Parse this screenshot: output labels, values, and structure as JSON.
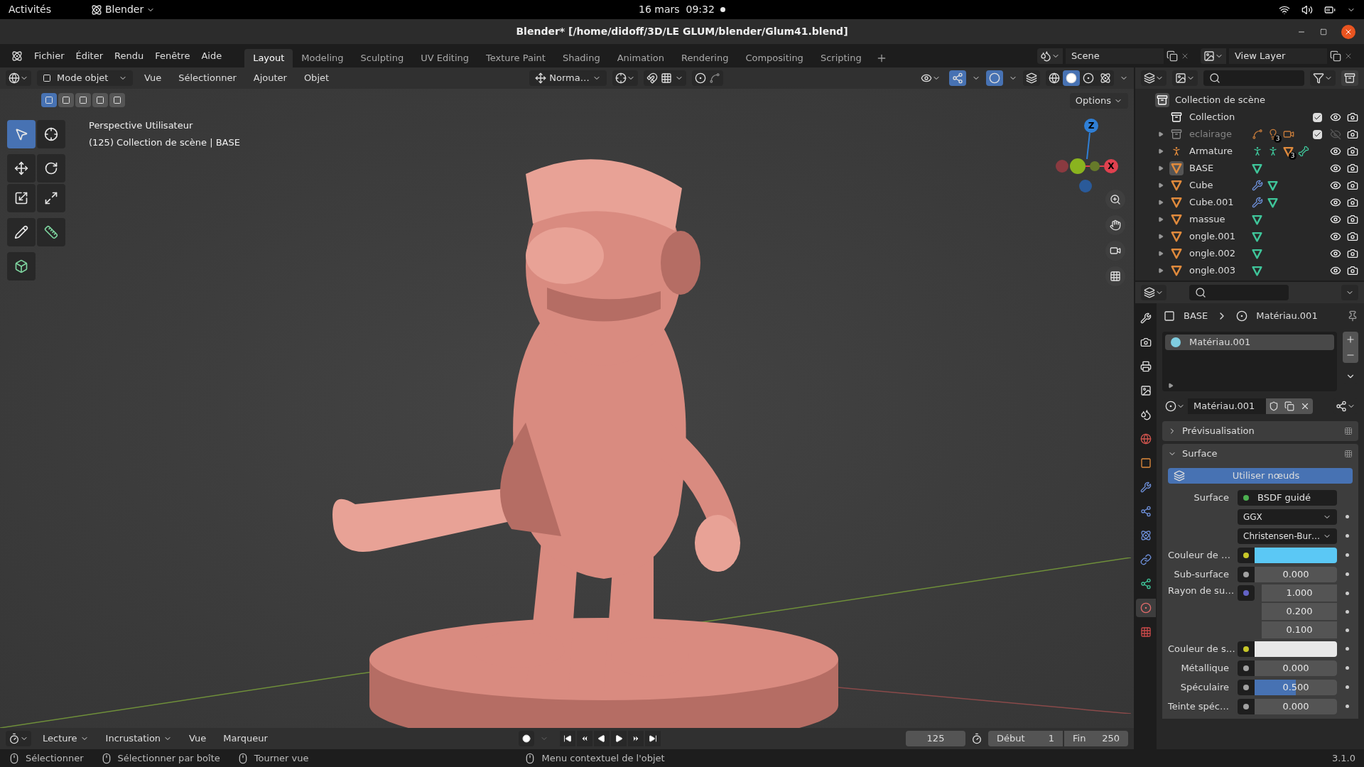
{
  "system_bar": {
    "activities": "Activités",
    "app": "Blender",
    "clock": "16 mars  09:32"
  },
  "window": {
    "title": "Blender* [/home/didoff/3D/LE GLUM/blender/Glum41.blend]"
  },
  "menu": [
    "Fichier",
    "Éditer",
    "Rendu",
    "Fenêtre",
    "Aide"
  ],
  "workspaces": [
    {
      "label": "Layout",
      "selected": true
    },
    {
      "label": "Modeling",
      "selected": false
    },
    {
      "label": "Sculpting",
      "selected": false
    },
    {
      "label": "UV Editing",
      "selected": false
    },
    {
      "label": "Texture Paint",
      "selected": false
    },
    {
      "label": "Shading",
      "selected": false
    },
    {
      "label": "Animation",
      "selected": false
    },
    {
      "label": "Rendering",
      "selected": false
    },
    {
      "label": "Compositing",
      "selected": false
    },
    {
      "label": "Scripting",
      "selected": false
    }
  ],
  "scene": "Scene",
  "view_layer": "View Layer",
  "viewport": {
    "mode": "Mode objet",
    "menus": [
      "Vue",
      "Sélectionner",
      "Ajouter",
      "Objet"
    ],
    "orientation": "Norma…",
    "options": "Options",
    "select_modes": [
      {
        "selected": true
      },
      {
        "selected": false
      },
      {
        "selected": false
      },
      {
        "selected": false
      },
      {
        "selected": false
      }
    ],
    "info": [
      "Perspective Utilisateur",
      "(125) Collection de scène | BASE"
    ],
    "tools": [
      {
        "kind": "select",
        "selected": true
      },
      {
        "kind": "cursor",
        "selected": false
      },
      {
        "kind": "move",
        "selected": false
      },
      {
        "kind": "rotate",
        "selected": false
      },
      {
        "kind": "scale",
        "selected": false
      },
      {
        "kind": "transform",
        "selected": false
      },
      {
        "kind": "annotate",
        "selected": false
      },
      {
        "kind": "measure",
        "selected": false
      },
      {
        "kind": "add_cube",
        "selected": false
      }
    ],
    "axes": [
      {
        "label": "Z",
        "color": "#2f7fd6"
      },
      {
        "label": "X",
        "color": "#e0414f"
      }
    ],
    "shading": [
      {
        "kind": "wireframe",
        "selected": false
      },
      {
        "kind": "solid",
        "selected": true
      },
      {
        "kind": "material",
        "selected": false
      },
      {
        "kind": "rendered",
        "selected": false
      }
    ]
  },
  "outliner": {
    "root": {
      "name": "Collection de scène",
      "children": [
        {
          "name": "Collection",
          "kind": "collection",
          "expandable": false,
          "checked": true,
          "visible": true,
          "disabled": false,
          "selected": false
        },
        {
          "name": "eclairage",
          "kind": "collection",
          "expandable": true,
          "checked": true,
          "visible": false,
          "disabled": true,
          "selected": false,
          "extras": [
            {
              "kind": "curve"
            },
            {
              "kind": "light",
              "count": "3"
            },
            {
              "kind": "camera"
            }
          ]
        },
        {
          "name": "Armature",
          "kind": "armature",
          "expandable": true,
          "visible": true,
          "disabled": false,
          "selected": false,
          "extras": [
            {
              "kind": "pose"
            },
            {
              "kind": "pose"
            },
            {
              "kind": "mesh_object",
              "count": "3"
            },
            {
              "kind": "bone"
            }
          ]
        },
        {
          "name": "BASE",
          "kind": "mesh_object",
          "expandable": true,
          "visible": true,
          "disabled": false,
          "selected": true,
          "extras": [
            {
              "kind": "mesh"
            }
          ]
        },
        {
          "name": "Cube",
          "kind": "mesh_object",
          "expandable": true,
          "visible": true,
          "disabled": false,
          "selected": false,
          "extras": [
            {
              "kind": "modifier"
            },
            {
              "kind": "mesh"
            }
          ]
        },
        {
          "name": "Cube.001",
          "kind": "mesh_object",
          "expandable": true,
          "visible": true,
          "disabled": false,
          "selected": false,
          "extras": [
            {
              "kind": "modifier"
            },
            {
              "kind": "mesh"
            }
          ]
        },
        {
          "name": "massue",
          "kind": "mesh_object",
          "expandable": true,
          "visible": true,
          "disabled": false,
          "selected": false,
          "extras": [
            {
              "kind": "mesh"
            }
          ]
        },
        {
          "name": "ongle.001",
          "kind": "mesh_object",
          "expandable": true,
          "visible": true,
          "disabled": false,
          "selected": false,
          "extras": [
            {
              "kind": "mesh"
            }
          ]
        },
        {
          "name": "ongle.002",
          "kind": "mesh_object",
          "expandable": true,
          "visible": true,
          "disabled": false,
          "selected": false,
          "extras": [
            {
              "kind": "mesh"
            }
          ]
        },
        {
          "name": "ongle.003",
          "kind": "mesh_object",
          "expandable": true,
          "visible": true,
          "disabled": false,
          "selected": false,
          "extras": [
            {
              "kind": "mesh"
            }
          ]
        }
      ]
    }
  },
  "properties": {
    "tabs": [
      {
        "kind": "tool",
        "selected": false
      },
      {
        "kind": "render",
        "selected": false
      },
      {
        "kind": "output",
        "selected": false
      },
      {
        "kind": "view_layer",
        "selected": false
      },
      {
        "kind": "scene",
        "selected": false
      },
      {
        "kind": "world",
        "selected": false
      },
      {
        "kind": "object",
        "selected": false
      },
      {
        "kind": "modifier",
        "selected": false
      },
      {
        "kind": "particles",
        "selected": false
      },
      {
        "kind": "physics",
        "selected": false
      },
      {
        "kind": "constraints",
        "selected": false
      },
      {
        "kind": "data",
        "selected": false
      },
      {
        "kind": "material",
        "selected": true
      },
      {
        "kind": "texture",
        "selected": false
      }
    ],
    "breadcrumb": [
      "BASE",
      "Matériau.001"
    ],
    "slots": [
      {
        "name": "Matériau.001",
        "selected": true
      }
    ],
    "material": "Matériau.001",
    "panels": [
      {
        "title": "Prévisualisation",
        "expanded": false
      },
      {
        "title": "Surface",
        "expanded": true
      }
    ],
    "use_nodes": "Utiliser nœuds",
    "rows": [
      {
        "kind": "link",
        "label": "Surface",
        "value": "BSDF guidé",
        "color": "#4caf50"
      },
      {
        "kind": "dropdown",
        "value": "GGX"
      },
      {
        "kind": "dropdown",
        "value": "Christensen-Bur…"
      },
      {
        "kind": "color",
        "label": "Couleur de …",
        "color": "#c7c729",
        "swatch": {
          "color": "#5bc8f5"
        }
      },
      {
        "kind": "number",
        "label": "Sub-surface",
        "value": "0.000",
        "color": "#a1a1a1"
      },
      {
        "kind": "vector",
        "label": "Rayon de su…",
        "values": [
          "1.000",
          "0.200",
          "0.100"
        ],
        "color": "#6363c7"
      },
      {
        "kind": "color",
        "label": "Couleur de s…",
        "color": "#c7c729",
        "swatch": {
          "color": "#e8e8e8"
        }
      },
      {
        "kind": "number",
        "label": "Métallique",
        "value": "0.000",
        "color": "#a1a1a1"
      },
      {
        "kind": "slider",
        "label": "Spéculaire",
        "value": "0.500",
        "level": 0.5,
        "color": "#a1a1a1"
      },
      {
        "kind": "number",
        "label": "Teinte spéc…",
        "value": "0.000",
        "color": "#a1a1a1"
      }
    ]
  },
  "timeline": {
    "menus": [
      "Lecture",
      "Incrustation",
      "Vue",
      "Marqueur"
    ],
    "frame": "125",
    "start_label": "Début",
    "start": "1",
    "end_label": "Fin",
    "end": "250"
  },
  "status": {
    "hints": [
      "Sélectionner",
      "Sélectionner par boîte",
      "Tourner vue",
      "Menu contextuel de l'objet"
    ],
    "version": "3.1.0"
  }
}
